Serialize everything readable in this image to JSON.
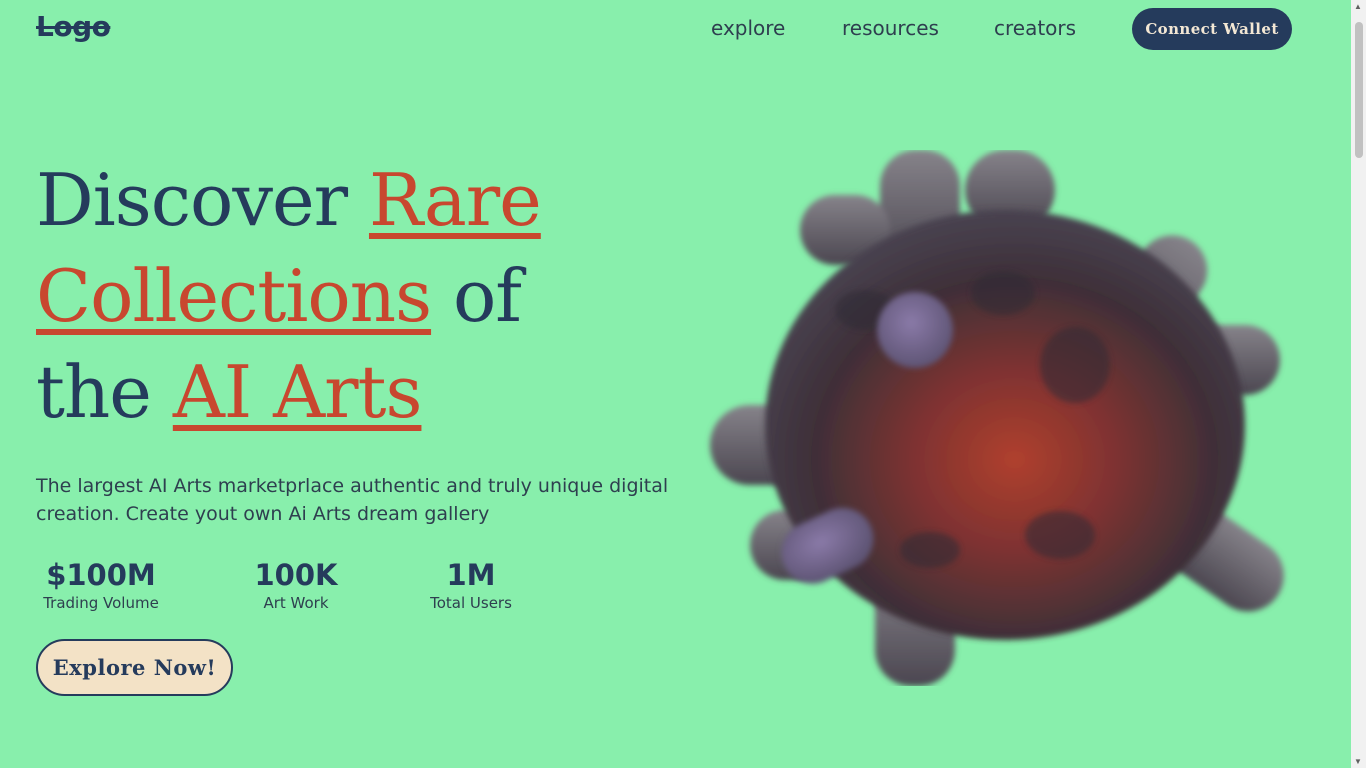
{
  "header": {
    "logo": "Logo",
    "nav": [
      "explore",
      "resources",
      "creators"
    ],
    "wallet_button": "Connect Wallet"
  },
  "hero": {
    "headline": {
      "w1": "Discover",
      "w2": "Rare",
      "w3": "Collections",
      "w4": "of",
      "w5": "the",
      "w6": "AI Arts"
    },
    "description": "The largest AI Arts marketprlace authentic and truly unique digital creation. Create yout own Ai Arts dream gallery",
    "stats": [
      {
        "value": "$100M",
        "label": "Trading Volume"
      },
      {
        "value": "100K",
        "label": "Art Work"
      },
      {
        "value": "1M",
        "label": "Total Users"
      }
    ],
    "cta": "Explore Now!"
  },
  "colors": {
    "background": "#88efac",
    "navy": "#253b5c",
    "accent": "#c8472f",
    "cta_bg": "#f3e2c6"
  },
  "art": {
    "icon": "abstract-3d-sculpture"
  }
}
